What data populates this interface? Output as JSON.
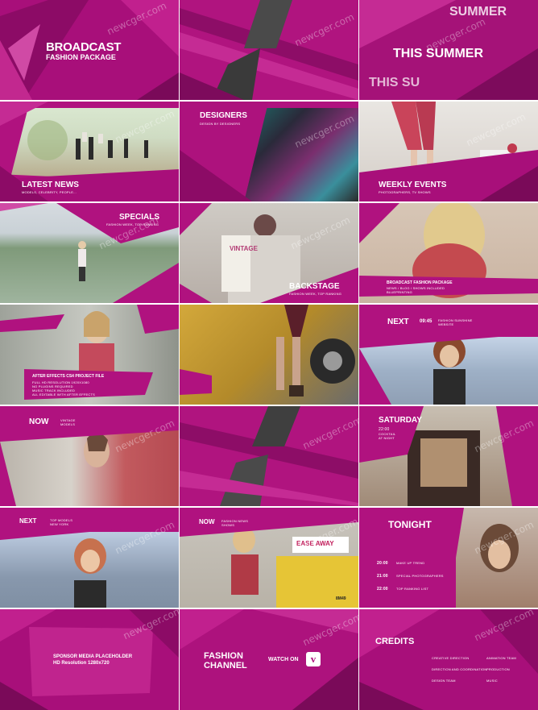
{
  "watermark": "newcger.com",
  "colors": {
    "magenta": "#b0127f",
    "magenta_light": "#e35fc0",
    "magenta_dark": "#6e0a50"
  },
  "tiles": {
    "t1": {
      "title1": "BROADCAST",
      "title2": "FASHION PACKAGE"
    },
    "t3": {
      "line1": "SUMMER",
      "line2": "THIS SUMMER",
      "line3": "THIS SU"
    },
    "t4": {
      "title": "LATEST NEWS",
      "sub": "MODELS, CELEBRITY, PEOPLE..."
    },
    "t5": {
      "title": "DESIGNERS",
      "sub": "DESIGN BY DESIGNERS"
    },
    "t6": {
      "title": "WEEKLY EVENTS",
      "sub": "PHOTOGRAPHERS, TV SHOWS"
    },
    "t7": {
      "title": "SPECIALS",
      "sub": "FASHION WEEK, TOP RANKING"
    },
    "t8": {
      "title": "BACKSTAGE",
      "sub": "FASHION WEEK, TOP RANKING",
      "sign": "VINTAGE"
    },
    "t9": {
      "title": "BROADCAST FASHION PACKAGE",
      "lines": [
        "NEWS / BLOG / SHOWS INCLUDED",
        "BLUEPRINTING"
      ]
    },
    "t10": {
      "title": "AFTER EFFECTS CS4 PROJECT FILE",
      "lines": [
        "FULL HD RESOLUTION 1920X1080",
        "NO PLUGINS REQUIRED",
        "MUSIC TRACK INCLUDED",
        "ALL EDITABLE WITH AFTER EFFECTS"
      ]
    },
    "t12": {
      "label": "NEXT",
      "time": "09:45",
      "sub1": "FASHION SUNSHINE",
      "sub2": "WEBSITE"
    },
    "t13": {
      "label": "NOW",
      "sub1": "VINTAGE",
      "sub2": "MODELS"
    },
    "t15": {
      "title": "SATURDAY",
      "time": "22:00",
      "sub1": "COCKTAIL",
      "sub2": "AT NIGHT"
    },
    "t16": {
      "label": "NEXT",
      "sub1": "TOP MODELS",
      "sub2": "NEW YORK"
    },
    "t17": {
      "label": "NOW",
      "sub1": "FASHION NEWS",
      "sub2": "SHOWS",
      "taxi_sign": "EASE AWAY",
      "plate": "8M49"
    },
    "t18": {
      "title": "TONIGHT",
      "schedule": [
        {
          "time": "20:00",
          "show": "MAKE UP TREND"
        },
        {
          "time": "21:00",
          "show": "SPECIAL PHOTOGRAPHERS"
        },
        {
          "time": "22:00",
          "show": "TOP RANKING LIST"
        }
      ]
    },
    "t19": {
      "line1": "SPONSOR MEDIA PLACEHOLDER",
      "line2": "HD Resolution 1280x720"
    },
    "t20": {
      "title1": "FASHION",
      "title2": "CHANNEL",
      "watch": "WATCH ON"
    },
    "t21": {
      "title": "CREDITS",
      "items": [
        "CREATIVE DIRECTION",
        "ANIMATION TEAM",
        "DIRECTION AND COORDINATION",
        "PRODUCTION",
        "DESIGN TEAM",
        "MUSIC"
      ]
    }
  }
}
